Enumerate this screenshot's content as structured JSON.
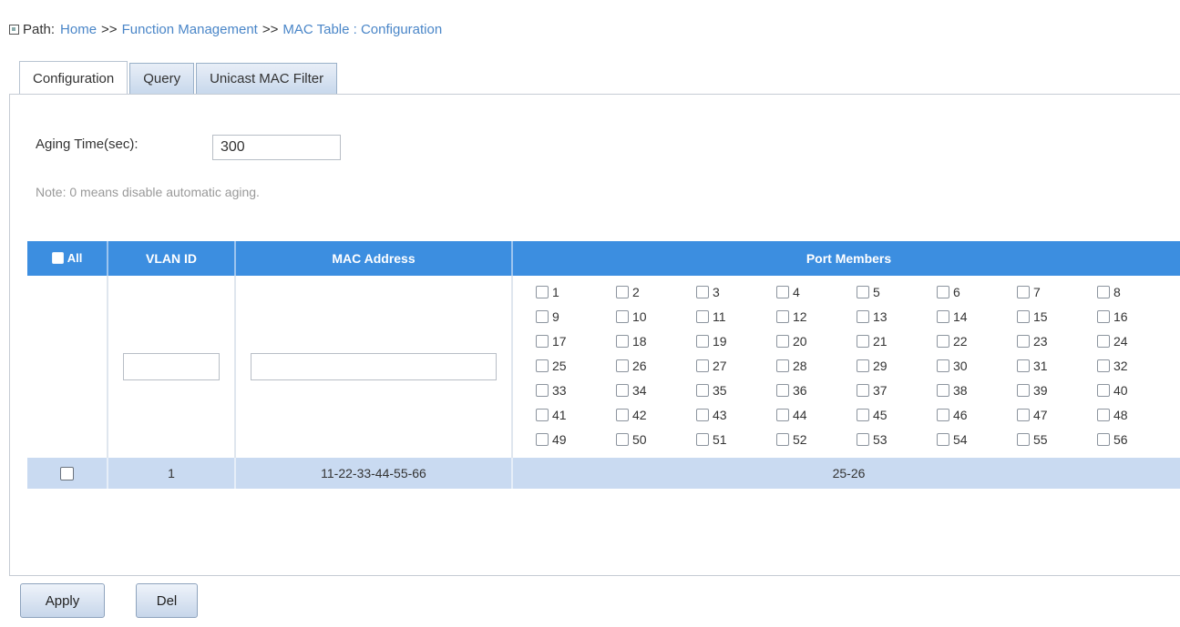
{
  "path": {
    "label": "Path:",
    "crumbs": [
      "Home",
      "Function Management",
      "MAC Table : Configuration"
    ],
    "separator": ">>"
  },
  "tabs": [
    "Configuration",
    "Query",
    "Unicast MAC Filter"
  ],
  "aging": {
    "label": "Aging Time(sec):",
    "value": "300",
    "note": "Note: 0 means disable automatic aging."
  },
  "table": {
    "headers": {
      "all": "All",
      "vlan": "VLAN ID",
      "mac": "MAC Address",
      "ports": "Port Members"
    },
    "port_labels": [
      "1",
      "2",
      "3",
      "4",
      "5",
      "6",
      "7",
      "8",
      "9",
      "10",
      "11",
      "12",
      "13",
      "14",
      "15",
      "16",
      "17",
      "18",
      "19",
      "20",
      "21",
      "22",
      "23",
      "24",
      "25",
      "26",
      "27",
      "28",
      "29",
      "30",
      "31",
      "32",
      "33",
      "34",
      "35",
      "36",
      "37",
      "38",
      "39",
      "40",
      "41",
      "42",
      "43",
      "44",
      "45",
      "46",
      "47",
      "48",
      "49",
      "50",
      "51",
      "52",
      "53",
      "54",
      "55",
      "56"
    ],
    "rows": [
      {
        "vlan": "1",
        "mac": "11-22-33-44-55-66",
        "ports": "25-26"
      }
    ]
  },
  "buttons": {
    "apply": "Apply",
    "del": "Del"
  },
  "colors": {
    "header": "#3c8ee0",
    "row": "#c9daf1",
    "link": "#4a86c8"
  }
}
